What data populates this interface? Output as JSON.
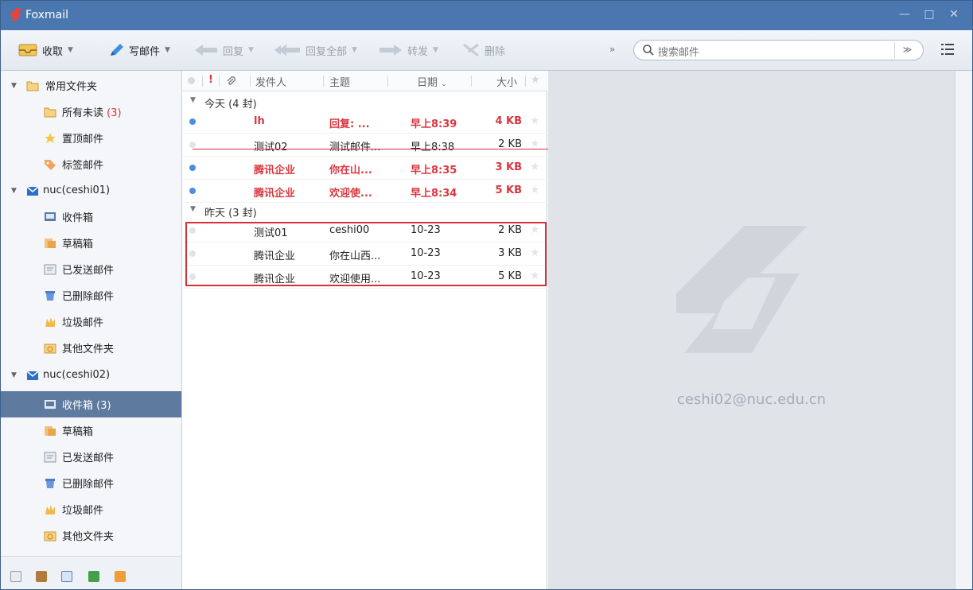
{
  "app": {
    "title": "Foxmail"
  },
  "window_controls": {
    "minimize": "—",
    "maximize": "□",
    "close": "✕"
  },
  "toolbar": {
    "receive": "收取",
    "compose": "写邮件",
    "reply": "回复",
    "reply_all": "回复全部",
    "forward": "转发",
    "delete": "删除",
    "more": "»",
    "search_placeholder": "搜索邮件",
    "search_dropdown": "≫"
  },
  "sidebar": {
    "favorites": {
      "label": "常用文件夹",
      "items": [
        {
          "label": "所有未读",
          "count": "(3)",
          "icon": "folder-icon"
        },
        {
          "label": "置顶邮件",
          "icon": "star-icon"
        },
        {
          "label": "标签邮件",
          "icon": "tag-icon"
        }
      ]
    },
    "accounts": [
      {
        "label": "nuc(ceshi01)",
        "folders": [
          {
            "label": "收件箱",
            "icon": "inbox-icon"
          },
          {
            "label": "草稿箱",
            "icon": "drafts-icon"
          },
          {
            "label": "已发送邮件",
            "icon": "sent-icon"
          },
          {
            "label": "已删除邮件",
            "icon": "trash-icon"
          },
          {
            "label": "垃圾邮件",
            "icon": "spam-icon"
          },
          {
            "label": "其他文件夹",
            "icon": "other-folder-icon"
          }
        ]
      },
      {
        "label": "nuc(ceshi02)",
        "folders": [
          {
            "label": "收件箱",
            "count": "(3)",
            "icon": "inbox-icon",
            "selected": true
          },
          {
            "label": "草稿箱",
            "icon": "drafts-icon"
          },
          {
            "label": "已发送邮件",
            "icon": "sent-icon"
          },
          {
            "label": "已删除邮件",
            "icon": "trash-icon"
          },
          {
            "label": "垃圾邮件",
            "icon": "spam-icon"
          },
          {
            "label": "其他文件夹",
            "icon": "other-folder-icon"
          }
        ]
      }
    ],
    "bottom_icons": [
      "mail-icon",
      "contacts-icon",
      "calendar-icon",
      "notes-icon",
      "rss-icon"
    ]
  },
  "mail_list": {
    "headers": {
      "from": "发件人",
      "subject": "主题",
      "date": "日期",
      "size": "大小"
    },
    "groups": [
      {
        "label": "今天 (4 封)",
        "mails": [
          {
            "from": "lh",
            "subject": "回复: ...",
            "date": "早上8:39",
            "size": "4 KB",
            "unread": true
          },
          {
            "from": "测试02",
            "subject": "测试邮件...",
            "date": "早上8:38",
            "size": "2 KB",
            "unread": false
          },
          {
            "from": "腾讯企业",
            "subject": "你在山...",
            "date": "早上8:35",
            "size": "3 KB",
            "unread": true
          },
          {
            "from": "腾讯企业",
            "subject": "欢迎使...",
            "date": "早上8:34",
            "size": "5 KB",
            "unread": true
          }
        ]
      },
      {
        "label": "昨天 (3 封)",
        "mails": [
          {
            "from": "测试01",
            "subject": "ceshi00",
            "date": "10-23",
            "size": "2 KB",
            "unread": false
          },
          {
            "from": "腾讯企业",
            "subject": "你在山西...",
            "date": "10-23",
            "size": "3 KB",
            "unread": false
          },
          {
            "from": "腾讯企业",
            "subject": "欢迎使用...",
            "date": "10-23",
            "size": "5 KB",
            "unread": false
          }
        ]
      }
    ]
  },
  "preview": {
    "account": "ceshi02@nuc.edu.cn"
  },
  "colors": {
    "titlebar": "#4a77b0",
    "unread_dot": "#4a8fe0",
    "read_dot": "#dfe4ea",
    "highlight_red": "#d53039",
    "selected_folder": "#5e7a9f"
  }
}
